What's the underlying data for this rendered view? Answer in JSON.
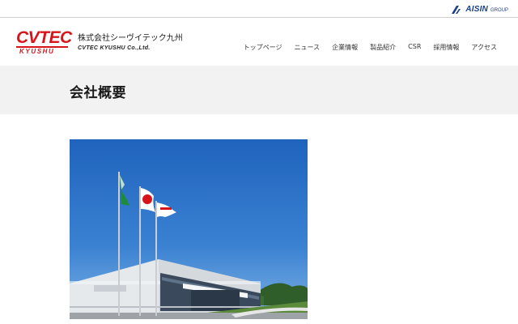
{
  "group_logo": {
    "brand": "AISIN",
    "suffix": "GROUP"
  },
  "brand": {
    "logo_top": "CVTEC",
    "logo_bottom": "KYUSHU",
    "company_jp": "株式会社シーヴイテック九州",
    "company_en": "CVTEC KYUSHU Co.,Ltd."
  },
  "nav": {
    "items": [
      {
        "label": "トップページ"
      },
      {
        "label": "ニュース"
      },
      {
        "label": "企業情報"
      },
      {
        "label": "製品紹介"
      },
      {
        "label": "CSR"
      },
      {
        "label": "採用情報"
      },
      {
        "label": "アクセス"
      }
    ]
  },
  "page": {
    "title": "会社概要"
  },
  "photo": {
    "subject": "factory-building-with-flags",
    "sky_color": "#2f74c8",
    "building_color": "#e9ecef"
  },
  "colors": {
    "brand_red": "#d7141a",
    "aisin_blue": "#1b3f86",
    "band_gray": "#f2f2f2"
  }
}
